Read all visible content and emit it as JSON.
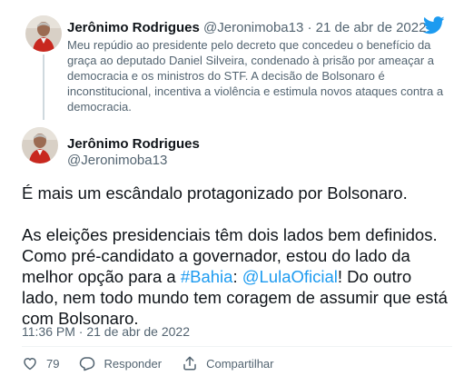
{
  "quoted": {
    "name": "Jerônimo Rodrigues",
    "handle": "@Jeronimoba13",
    "separator": "·",
    "date": "21 de abr de 2022",
    "text": "Meu repúdio ao presidente pelo decreto que concedeu o benefício da graça ao deputado Daniel Silveira, condenado à prisão por ameaçar a democracia e os ministros do STF. A decisão de Bolsonaro é inconstitucional, incentiva a violência e estimula novos ataques contra a democracia."
  },
  "tweet": {
    "name": "Jerônimo Rodrigues",
    "handle": "@Jeronimoba13",
    "paragraph1": "É mais um escândalo protagonizado por Bolsonaro.",
    "p2_before": "As eleições presidenciais têm dois lados bem definidos. Como pré-candidato a governador, estou do lado da melhor opção para a ",
    "hashtag": "#Bahia",
    "p2_colon": ": ",
    "mention": "@LulaOficial",
    "p2_after": "! Do outro lado, nem todo mundo tem coragem de assumir que está com Bolsonaro.",
    "timestamp": "11:36 PM · 21 de abr de 2022"
  },
  "actions": {
    "like_count": "79",
    "reply_label": "Responder",
    "share_label": "Compartilhar"
  },
  "icons": {
    "brand": "twitter-bird-icon",
    "like": "heart-icon",
    "reply": "reply-icon",
    "share": "share-icon"
  },
  "colors": {
    "brand_blue": "#1d9bf0",
    "secondary_text": "#536471",
    "primary_text": "#0f1419",
    "rail": "#cfd9de"
  }
}
